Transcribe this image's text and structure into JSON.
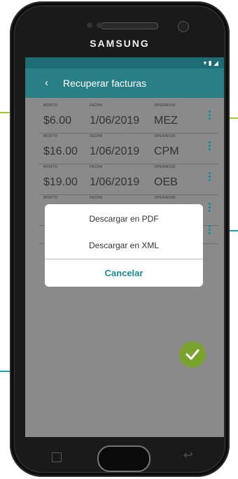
{
  "device": {
    "brand": "SAMSUNG"
  },
  "status_bar": {
    "icons": "▾ ▮ ◢"
  },
  "app_bar": {
    "back_icon": "‹",
    "title": "Recuperar facturas"
  },
  "invoice_labels": {
    "amount": "MONTO",
    "date": "FECHA",
    "operator": "OPERADOR"
  },
  "invoices": [
    {
      "amount": "$6.00",
      "date": "1/06/2019",
      "operator": "MEZ"
    },
    {
      "amount": "$16.00",
      "date": "1/06/2019",
      "operator": "CPM"
    },
    {
      "amount": "$19.00",
      "date": "1/06/2019",
      "operator": "OEB"
    }
  ],
  "dialog": {
    "option_pdf": "Descargar en PDF",
    "option_xml": "Descargar en XML",
    "cancel": "Cancelar"
  },
  "colors": {
    "accent": "#2a7f87",
    "menu_dots": "#0b8fa0",
    "fab": "#7aa32d",
    "callout": "#9acd32"
  }
}
